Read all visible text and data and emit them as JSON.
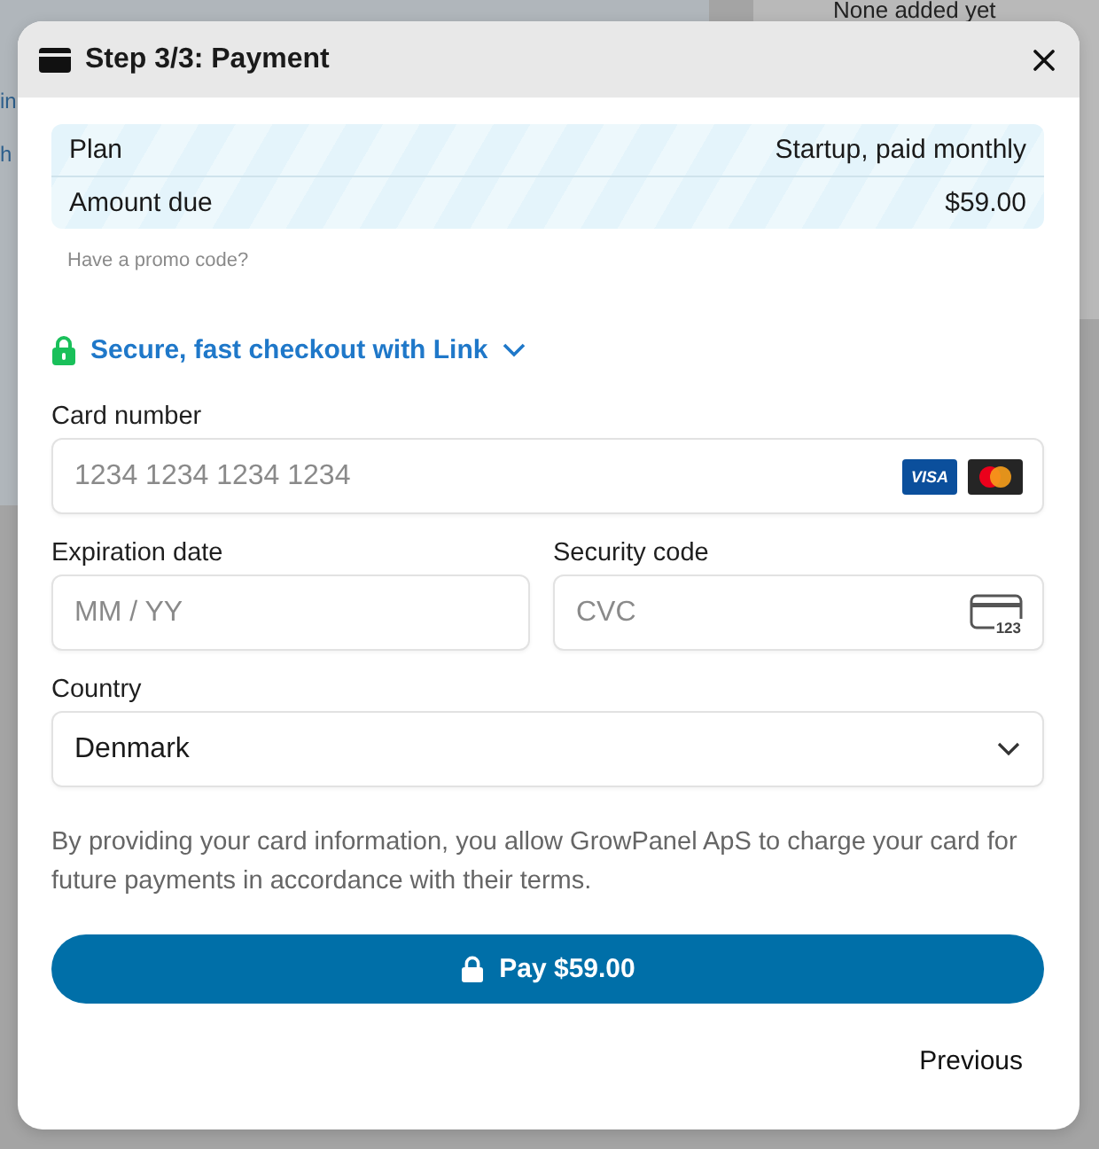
{
  "background_page": {
    "side_text": "None added yet",
    "fragments": [
      "in",
      "h"
    ]
  },
  "dialog": {
    "title": "Step 3/3: Payment"
  },
  "summary": [
    {
      "label": "Plan",
      "value": "Startup, paid monthly"
    },
    {
      "label": "Amount due",
      "value": "$59.00"
    }
  ],
  "promo_link": "Have a promo code?",
  "checkout_link": "Secure, fast checkout with Link",
  "card_number": {
    "label": "Card number",
    "placeholder": "1234 1234 1234 1234",
    "brand_badge": "VISA"
  },
  "expiration": {
    "label": "Expiration date",
    "placeholder": "MM / YY"
  },
  "security_code": {
    "label": "Security code",
    "placeholder": "CVC",
    "icon_text": "123"
  },
  "country": {
    "label": "Country",
    "value": "Denmark"
  },
  "terms": "By providing your card information, you allow GrowPanel ApS to charge your card for future payments in accordance with their terms.",
  "pay_button": "Pay $59.00",
  "previous_button": "Previous"
}
